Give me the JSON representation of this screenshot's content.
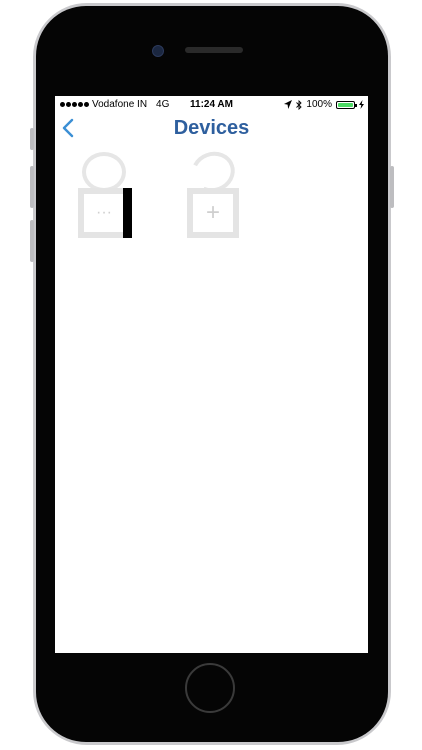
{
  "status_bar": {
    "carrier": "Vodafone IN",
    "network": "4G",
    "time": "11:24 AM",
    "battery_percent": "100%",
    "battery_level": 1.0,
    "battery_color": "#4cd964"
  },
  "nav": {
    "title": "Devices",
    "back_icon": "chevron-left-icon",
    "title_color": "#2e5f9e",
    "accent_color": "#3b8fd4"
  },
  "devices": {
    "items": [
      {
        "glyph": "···",
        "icon": "lock-icon"
      },
      {
        "glyph": "+",
        "icon": "lock-add-icon"
      }
    ]
  }
}
